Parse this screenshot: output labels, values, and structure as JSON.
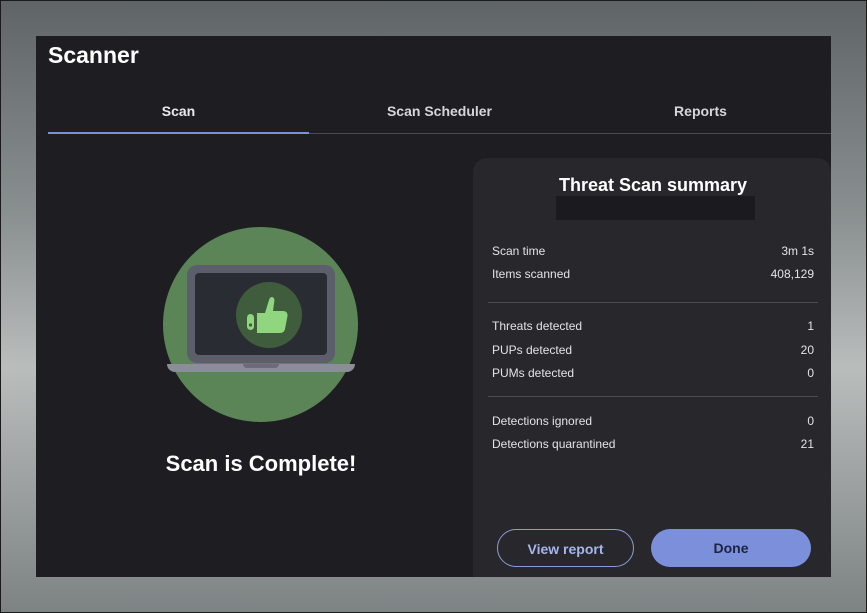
{
  "window": {
    "title": "Scanner"
  },
  "tabs": [
    {
      "label": "Scan",
      "active": true
    },
    {
      "label": "Scan Scheduler",
      "active": false
    },
    {
      "label": "Reports",
      "active": false
    }
  ],
  "status": {
    "message": "Scan is Complete!",
    "icon": "thumbs-up-laptop-icon"
  },
  "summary": {
    "title": "Threat Scan summary",
    "group1": [
      {
        "label": "Scan time",
        "value": "3m 1s"
      },
      {
        "label": "Items scanned",
        "value": "408,129"
      }
    ],
    "group2": [
      {
        "label": "Threats detected",
        "value": "1"
      },
      {
        "label": "PUPs detected",
        "value": "20"
      },
      {
        "label": "PUMs detected",
        "value": "0"
      }
    ],
    "group3": [
      {
        "label": "Detections ignored",
        "value": "0"
      },
      {
        "label": "Detections quarantined",
        "value": "21"
      }
    ]
  },
  "actions": {
    "view_report": "View report",
    "done": "Done"
  },
  "colors": {
    "accent": "#7b8fdb",
    "success_green": "#5b8457",
    "thumb_green": "#8fd67e",
    "window_bg": "#1e1e22",
    "card_bg": "#27272c"
  }
}
